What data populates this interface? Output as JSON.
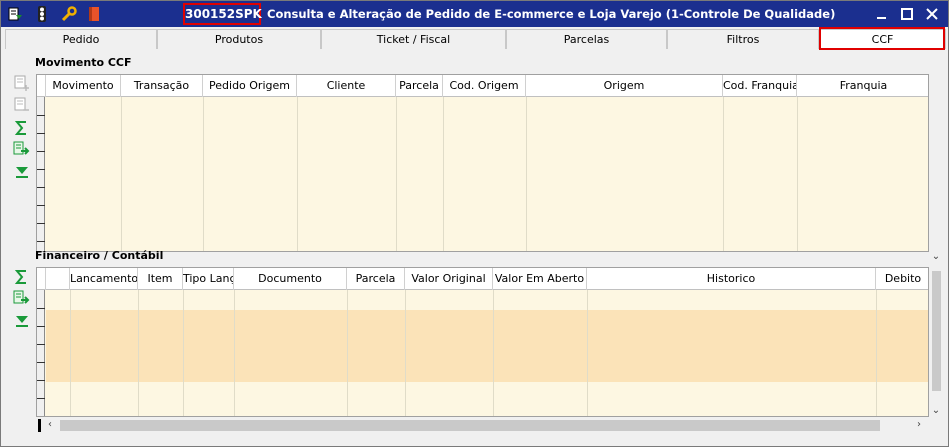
{
  "window": {
    "code": "300152SPK",
    "title": "Consulta e Alteração de Pedido de E-commerce e Loja Varejo (1-Controle De Qualidade)",
    "icons": [
      "menu-icon",
      "traffic-light-icon",
      "wrench-icon",
      "book-icon"
    ],
    "controls": [
      "minimize-icon",
      "maximize-icon",
      "close-icon"
    ],
    "title_color": "#1b2f8f",
    "highlight_color": "#e00000"
  },
  "tabs": [
    {
      "label": "Pedido"
    },
    {
      "label": "Produtos"
    },
    {
      "label": "Ticket / Fiscal"
    },
    {
      "label": "Parcelas"
    },
    {
      "label": "Filtros"
    },
    {
      "label": "CCF"
    }
  ],
  "active_tab": "CCF",
  "movimento": {
    "title": "Movimento CCF",
    "tools": [
      "add-record-icon",
      "remove-record-icon",
      "sum-icon",
      "export-icon",
      "filter-icon"
    ],
    "columns": [
      "Movimento",
      "Transação",
      "Pedido Origem",
      "Cliente",
      "Parcela",
      "Cod. Origem",
      "Origem",
      "Cod. Franquia",
      "Franquia"
    ]
  },
  "financeiro": {
    "title": "Financeiro / Contábil",
    "tools": [
      "sum-icon",
      "export-icon",
      "filter-icon"
    ],
    "columns": [
      "",
      "Lancamento",
      "Item",
      "Tipo Lanç.",
      "Documento",
      "Parcela",
      "Valor Original",
      "Valor Em Aberto",
      "Historico",
      "Debito"
    ]
  },
  "grid_background": "#fdf7e2",
  "selected_row_color": "#fbe3b8"
}
